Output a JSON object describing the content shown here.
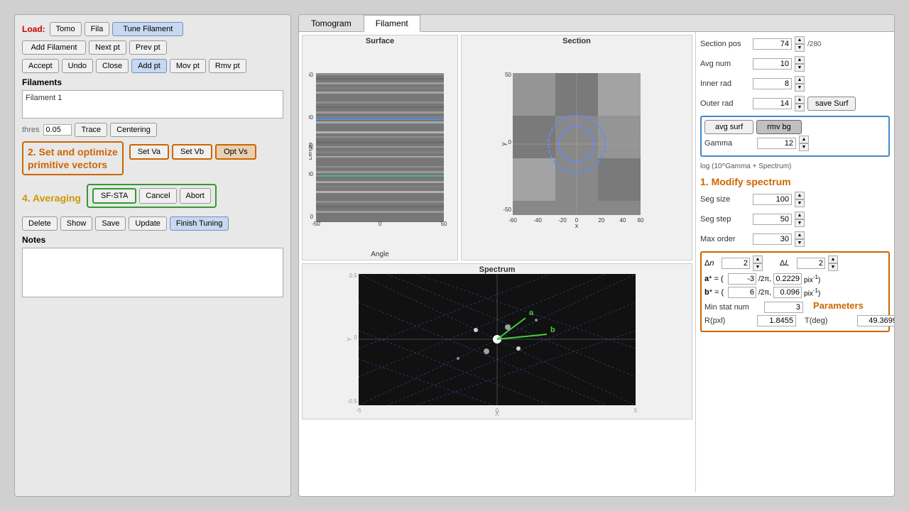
{
  "tabs": {
    "tomogram": "Tomogram",
    "filament": "Filament"
  },
  "left": {
    "load_label": "Load:",
    "tomo_btn": "Tomo",
    "fila_btn": "Fila",
    "tune_filament_btn": "Tune Filament",
    "add_filament_btn": "Add Filament",
    "next_pt_btn": "Next pt",
    "prev_pt_btn": "Prev pt",
    "accept_btn": "Accept",
    "undo_btn": "Undo",
    "close_btn": "Close",
    "add_pt_btn": "Add pt",
    "mov_pt_btn": "Mov pt",
    "rmv_pt_btn": "Rmv pt",
    "filaments_label": "Filaments",
    "filament1": "Filament 1",
    "thres_label": "thres",
    "thres_value": "0.05",
    "trace_btn": "Trace",
    "centering_btn": "Centering",
    "annotation2_line1": "2. Set and optimize",
    "annotation2_line2": "primitive vectors",
    "set_va_btn": "Set Va",
    "set_vb_btn": "Set Vb",
    "opt_vs_btn": "Opt Vs",
    "annotation4_label": "4. Averaging",
    "sf_sta_btn": "SF-STA",
    "cancel_btn": "Cancel",
    "abort_btn": "Abort",
    "delete_btn": "Delete",
    "show_btn": "Show",
    "save_btn": "Save",
    "update_btn": "Update",
    "finish_tuning_btn": "Finish Tuning",
    "notes_label": "Notes"
  },
  "controls": {
    "section_pos_label": "Section pos",
    "section_pos_value": "74",
    "section_pos_max": "/280",
    "avg_num_label": "Avg num",
    "avg_num_value": "10",
    "inner_rad_label": "Inner rad",
    "inner_rad_value": "8",
    "outer_rad_label": "Outer rad",
    "outer_rad_value": "14",
    "save_surf_btn": "save Surf",
    "avg_surf_btn": "avg surf",
    "rmv_bg_btn": "rmv bg",
    "gamma_label": "Gamma",
    "gamma_value": "12",
    "log_text": "log (10^Gamma + Spectrum)",
    "modify_spectrum_title": "1. Modify spectrum",
    "seg_size_label": "Seg size",
    "seg_size_value": "100",
    "seg_step_label": "Seg step",
    "seg_step_value": "50",
    "max_order_label": "Max order",
    "max_order_value": "30",
    "delta_n_label": "Δn",
    "delta_n_value": "2",
    "delta_l_label": "ΔL",
    "delta_l_value": "2",
    "a_star_label": "a* = (",
    "a_star_val1": "-3",
    "a_star_slash": "/2π,",
    "a_star_val2": "0.2229",
    "a_star_unit": "pix⁻¹)",
    "b_star_label": "b* = (",
    "b_star_val1": "6",
    "b_star_slash": "/2π,",
    "b_star_val2": "0.096",
    "b_star_unit": "pix⁻¹)",
    "min_stat_label": "Min stat num",
    "min_stat_value": "3",
    "params_title": "Parameters",
    "r_pxl_label": "R(pxl)",
    "r_pxl_value": "1.8455",
    "t_deg_label": "T(deg)",
    "t_deg_value": "49.3699"
  },
  "plots": {
    "surface_title": "Surface",
    "surface_xlabel": "Angle",
    "section_title": "Section",
    "section_xlabel": "x",
    "section_ylabel": "y",
    "spectrum_title": "Spectrum",
    "spectrum_xlabel": "X",
    "spectrum_ylabel": "Y",
    "vector_a": "a",
    "vector_b": "b"
  }
}
